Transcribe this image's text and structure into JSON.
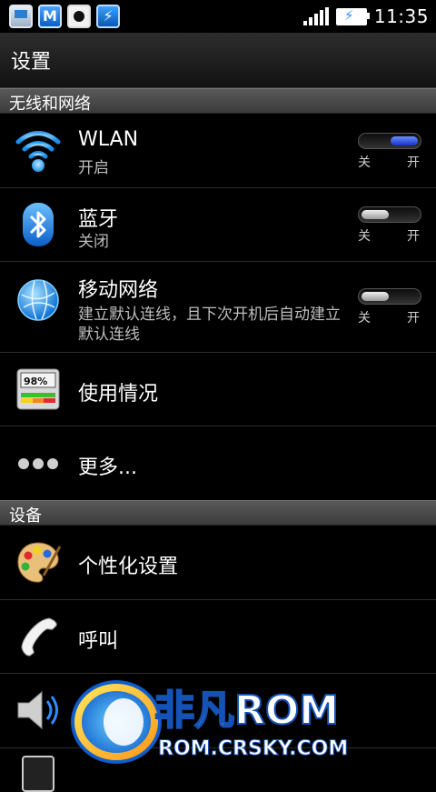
{
  "status_bar": {
    "time": "11:35",
    "icons": [
      "monitor-icon",
      "m-app-icon",
      "satellite-icon",
      "shield-bolt-icon",
      "signal-icon",
      "battery-charging-icon"
    ]
  },
  "header": {
    "title": "设置"
  },
  "sections": {
    "wireless": "无线和网络",
    "device": "设备"
  },
  "rows": {
    "wlan": {
      "title": "WLAN",
      "summary": "开启",
      "toggle_on": true,
      "off_label": "关",
      "on_label": "开"
    },
    "bluetooth": {
      "title": "蓝牙",
      "summary": "关闭",
      "toggle_on": false,
      "off_label": "关",
      "on_label": "开"
    },
    "mobile": {
      "title": "移动网络",
      "summary": "建立默认连线，且下次开机后自动建立默认连线",
      "toggle_on": false,
      "off_label": "关",
      "on_label": "开"
    },
    "usage": {
      "title": "使用情况",
      "icon_text": "98%"
    },
    "more": {
      "title": "更多..."
    },
    "personalize": {
      "title": "个性化设置"
    },
    "call": {
      "title": "呼叫"
    }
  },
  "watermark": {
    "brand": "非凡ROM",
    "url": "ROM.CRSKY.COM"
  },
  "colors": {
    "toggle_on": "#2340d8",
    "section_bg": "#4a4a4a",
    "accent": "#2d8cff"
  }
}
